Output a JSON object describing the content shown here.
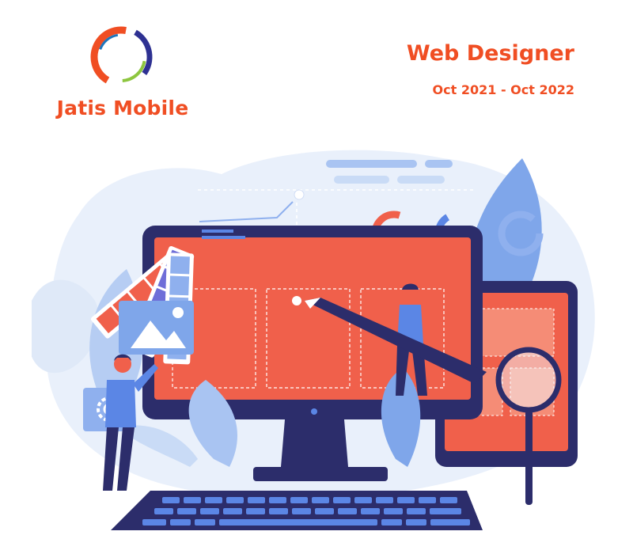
{
  "company": {
    "name": "Jatis Mobile",
    "logo_colors": [
      "#f04e23",
      "#2e3192",
      "#8dc63f",
      "#1c75bc"
    ]
  },
  "position": {
    "title": "Web Designer",
    "period": "Oct 2021 - Oct 2022"
  },
  "illustration": {
    "subject": "web designer workspace",
    "colors": {
      "accent": "#f0604b",
      "navy": "#2c2d6b",
      "blue": "#5b86e5",
      "light_blue": "#a9c4f2",
      "pale_blue": "#dfe9f8"
    }
  }
}
